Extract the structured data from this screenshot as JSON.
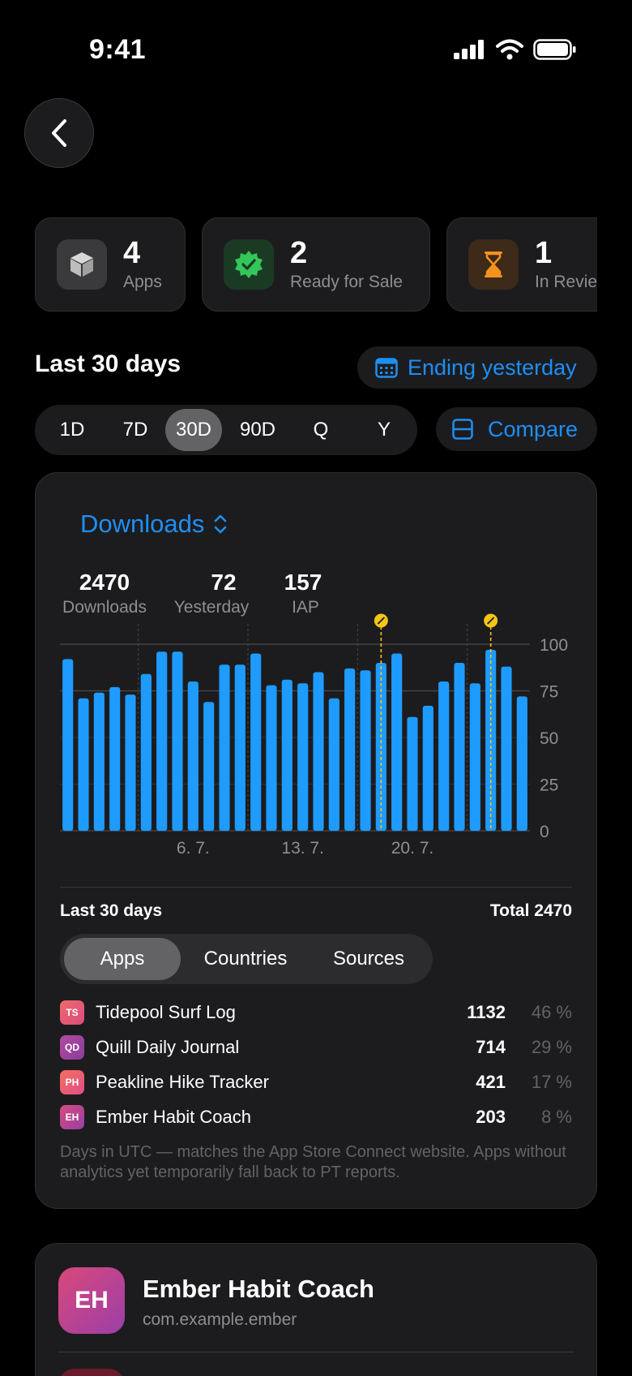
{
  "status_bar": {
    "time": "9:41"
  },
  "stats": [
    {
      "value": "4",
      "label": "Apps",
      "icon": "cube-icon"
    },
    {
      "value": "2",
      "label": "Ready for Sale",
      "icon": "verified-badge-icon"
    },
    {
      "value": "1",
      "label": "In Review",
      "icon": "hourglass-icon"
    }
  ],
  "header": {
    "title": "Last 30 days",
    "ending_label": "Ending yesterday",
    "compare_label": "Compare"
  },
  "ranges": [
    "1D",
    "7D",
    "30D",
    "90D",
    "Q",
    "Y"
  ],
  "selected_range": "30D",
  "metric": {
    "label": "Downloads"
  },
  "kpis": [
    {
      "value": "2470",
      "label": "Downloads"
    },
    {
      "value": "72",
      "label": "Yesterday"
    },
    {
      "value": "157",
      "label": "IAP"
    }
  ],
  "chart_data": {
    "type": "bar",
    "values": [
      92,
      71,
      74,
      77,
      73,
      84,
      96,
      96,
      80,
      69,
      89,
      89,
      95,
      78,
      81,
      79,
      85,
      71,
      87,
      86,
      90,
      95,
      61,
      67,
      80,
      90,
      79,
      97,
      88,
      72
    ],
    "x_tick_labels": [
      "6. 7.",
      "13. 7.",
      "20. 7."
    ],
    "x_tick_indices": [
      8,
      15,
      22
    ],
    "weekly_gridline_after": [
      4,
      11,
      18,
      25
    ],
    "event_marker_indices": [
      20,
      27
    ],
    "y_ticks": [
      "0",
      "25",
      "50",
      "75",
      "100"
    ],
    "ylim": [
      0,
      100
    ],
    "bar_color": "#1e9bff"
  },
  "summary": {
    "title": "Last 30 days",
    "total": "Total 2470",
    "tabs": [
      "Apps",
      "Countries",
      "Sources"
    ],
    "selected_tab": "Apps",
    "rows": [
      {
        "badge": "TS",
        "name": "Tidepool Surf Log",
        "count": "1132",
        "pct": "46 %",
        "color": "#e8617a"
      },
      {
        "badge": "QD",
        "name": "Quill Daily Journal",
        "count": "714",
        "pct": "29 %",
        "color": "#a445a0"
      },
      {
        "badge": "PH",
        "name": "Peakline Hike Tracker",
        "count": "421",
        "pct": "17 %",
        "color": "#ec5e78"
      },
      {
        "badge": "EH",
        "name": "Ember Habit Coach",
        "count": "203",
        "pct": "8 %",
        "color": "#c2488c"
      }
    ],
    "footnote": "Days in UTC — matches the App Store Connect website. Apps without analytics yet temporarily fall back to PT reports."
  },
  "app": {
    "badge": "EH",
    "name": "Ember Habit Coach",
    "bundle": "com.example.ember"
  }
}
